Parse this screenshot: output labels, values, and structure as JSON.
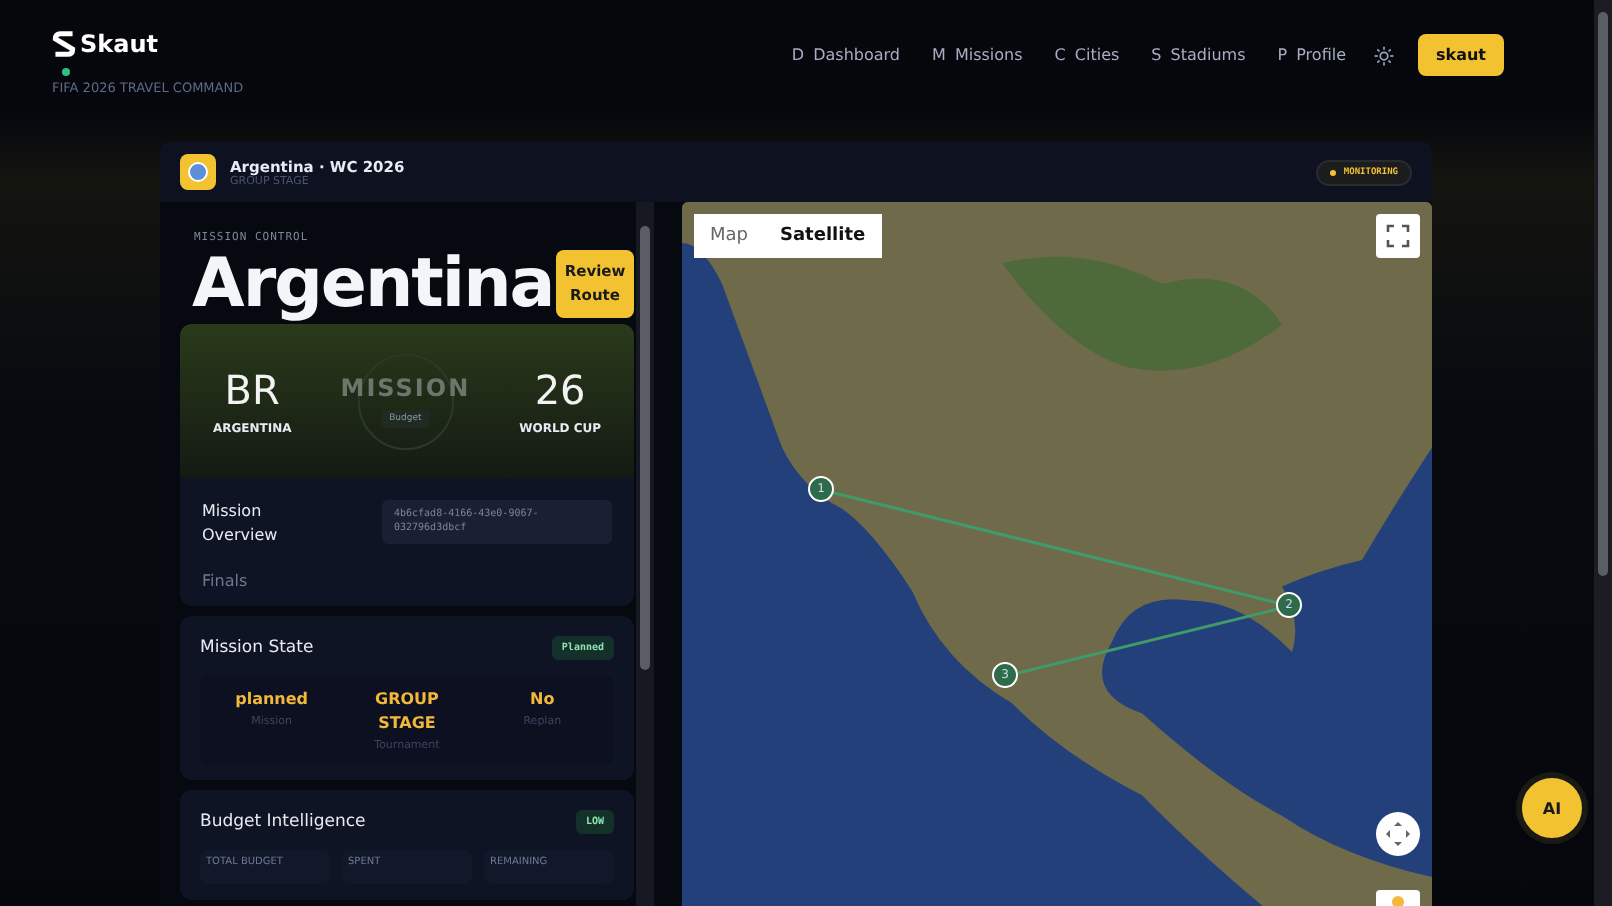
{
  "nav": {
    "brand": "Skaut",
    "tagline": "FIFA 2026 TRAVEL COMMAND",
    "links": [
      {
        "key": "D",
        "label": "Dashboard"
      },
      {
        "key": "M",
        "label": "Missions"
      },
      {
        "key": "C",
        "label": "Cities"
      },
      {
        "key": "S",
        "label": "Stadiums"
      },
      {
        "key": "P",
        "label": "Profile"
      }
    ],
    "user": "skaut"
  },
  "mission": {
    "title": "Argentina · WC 2026",
    "subtitle": "GROUP STAGE",
    "status": "MONITORING"
  },
  "panel": {
    "eyebrow": "MISSION CONTROL",
    "heading": "Argentina",
    "action": "Review Route",
    "hero": {
      "left_code": "BR",
      "left_label": "ARGENTINA",
      "center_word": "MISSION",
      "center_tag": "Budget",
      "right_code": "26",
      "right_label": "WORLD CUP"
    },
    "overview": {
      "label": "Mission Overview",
      "id": "4b6cfad8-4166-43e0-9067-032796d3dbcf",
      "stage": "Finals"
    },
    "state": {
      "title": "Mission State",
      "badge": "Planned",
      "stats": [
        {
          "value": "planned",
          "label": "Mission"
        },
        {
          "value": "GROUP STAGE",
          "label": "Tournament"
        },
        {
          "value": "No",
          "label": "Replan"
        }
      ]
    },
    "budget": {
      "title": "Budget Intelligence",
      "badge": "LOW",
      "stats": [
        {
          "label": "TOTAL BUDGET"
        },
        {
          "label": "SPENT"
        },
        {
          "label": "REMAINING"
        }
      ]
    }
  },
  "map": {
    "modes": [
      {
        "label": "Map",
        "selected": false
      },
      {
        "label": "Satellite",
        "selected": true
      }
    ],
    "stops": [
      {
        "label": "1"
      },
      {
        "label": "2"
      },
      {
        "label": "3"
      }
    ]
  },
  "assistant": "AI"
}
